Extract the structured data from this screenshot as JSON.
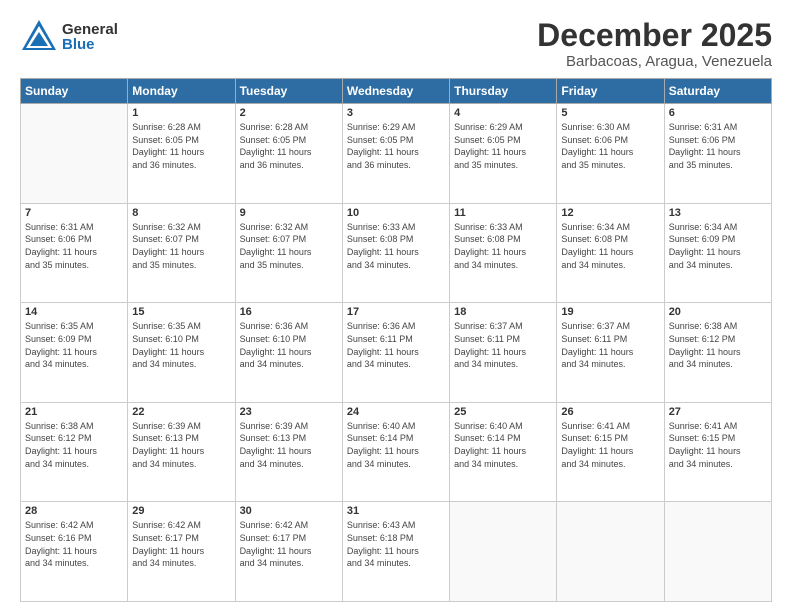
{
  "header": {
    "logo_general": "General",
    "logo_blue": "Blue",
    "month": "December 2025",
    "location": "Barbacoas, Aragua, Venezuela"
  },
  "weekdays": [
    "Sunday",
    "Monday",
    "Tuesday",
    "Wednesday",
    "Thursday",
    "Friday",
    "Saturday"
  ],
  "weeks": [
    [
      {
        "day": "",
        "sunrise": "",
        "sunset": "",
        "daylight": ""
      },
      {
        "day": "1",
        "sunrise": "Sunrise: 6:28 AM",
        "sunset": "Sunset: 6:05 PM",
        "daylight": "Daylight: 11 hours and 36 minutes."
      },
      {
        "day": "2",
        "sunrise": "Sunrise: 6:28 AM",
        "sunset": "Sunset: 6:05 PM",
        "daylight": "Daylight: 11 hours and 36 minutes."
      },
      {
        "day": "3",
        "sunrise": "Sunrise: 6:29 AM",
        "sunset": "Sunset: 6:05 PM",
        "daylight": "Daylight: 11 hours and 36 minutes."
      },
      {
        "day": "4",
        "sunrise": "Sunrise: 6:29 AM",
        "sunset": "Sunset: 6:05 PM",
        "daylight": "Daylight: 11 hours and 35 minutes."
      },
      {
        "day": "5",
        "sunrise": "Sunrise: 6:30 AM",
        "sunset": "Sunset: 6:06 PM",
        "daylight": "Daylight: 11 hours and 35 minutes."
      },
      {
        "day": "6",
        "sunrise": "Sunrise: 6:31 AM",
        "sunset": "Sunset: 6:06 PM",
        "daylight": "Daylight: 11 hours and 35 minutes."
      }
    ],
    [
      {
        "day": "7",
        "sunrise": "Sunrise: 6:31 AM",
        "sunset": "Sunset: 6:06 PM",
        "daylight": "Daylight: 11 hours and 35 minutes."
      },
      {
        "day": "8",
        "sunrise": "Sunrise: 6:32 AM",
        "sunset": "Sunset: 6:07 PM",
        "daylight": "Daylight: 11 hours and 35 minutes."
      },
      {
        "day": "9",
        "sunrise": "Sunrise: 6:32 AM",
        "sunset": "Sunset: 6:07 PM",
        "daylight": "Daylight: 11 hours and 35 minutes."
      },
      {
        "day": "10",
        "sunrise": "Sunrise: 6:33 AM",
        "sunset": "Sunset: 6:08 PM",
        "daylight": "Daylight: 11 hours and 34 minutes."
      },
      {
        "day": "11",
        "sunrise": "Sunrise: 6:33 AM",
        "sunset": "Sunset: 6:08 PM",
        "daylight": "Daylight: 11 hours and 34 minutes."
      },
      {
        "day": "12",
        "sunrise": "Sunrise: 6:34 AM",
        "sunset": "Sunset: 6:08 PM",
        "daylight": "Daylight: 11 hours and 34 minutes."
      },
      {
        "day": "13",
        "sunrise": "Sunrise: 6:34 AM",
        "sunset": "Sunset: 6:09 PM",
        "daylight": "Daylight: 11 hours and 34 minutes."
      }
    ],
    [
      {
        "day": "14",
        "sunrise": "Sunrise: 6:35 AM",
        "sunset": "Sunset: 6:09 PM",
        "daylight": "Daylight: 11 hours and 34 minutes."
      },
      {
        "day": "15",
        "sunrise": "Sunrise: 6:35 AM",
        "sunset": "Sunset: 6:10 PM",
        "daylight": "Daylight: 11 hours and 34 minutes."
      },
      {
        "day": "16",
        "sunrise": "Sunrise: 6:36 AM",
        "sunset": "Sunset: 6:10 PM",
        "daylight": "Daylight: 11 hours and 34 minutes."
      },
      {
        "day": "17",
        "sunrise": "Sunrise: 6:36 AM",
        "sunset": "Sunset: 6:11 PM",
        "daylight": "Daylight: 11 hours and 34 minutes."
      },
      {
        "day": "18",
        "sunrise": "Sunrise: 6:37 AM",
        "sunset": "Sunset: 6:11 PM",
        "daylight": "Daylight: 11 hours and 34 minutes."
      },
      {
        "day": "19",
        "sunrise": "Sunrise: 6:37 AM",
        "sunset": "Sunset: 6:11 PM",
        "daylight": "Daylight: 11 hours and 34 minutes."
      },
      {
        "day": "20",
        "sunrise": "Sunrise: 6:38 AM",
        "sunset": "Sunset: 6:12 PM",
        "daylight": "Daylight: 11 hours and 34 minutes."
      }
    ],
    [
      {
        "day": "21",
        "sunrise": "Sunrise: 6:38 AM",
        "sunset": "Sunset: 6:12 PM",
        "daylight": "Daylight: 11 hours and 34 minutes."
      },
      {
        "day": "22",
        "sunrise": "Sunrise: 6:39 AM",
        "sunset": "Sunset: 6:13 PM",
        "daylight": "Daylight: 11 hours and 34 minutes."
      },
      {
        "day": "23",
        "sunrise": "Sunrise: 6:39 AM",
        "sunset": "Sunset: 6:13 PM",
        "daylight": "Daylight: 11 hours and 34 minutes."
      },
      {
        "day": "24",
        "sunrise": "Sunrise: 6:40 AM",
        "sunset": "Sunset: 6:14 PM",
        "daylight": "Daylight: 11 hours and 34 minutes."
      },
      {
        "day": "25",
        "sunrise": "Sunrise: 6:40 AM",
        "sunset": "Sunset: 6:14 PM",
        "daylight": "Daylight: 11 hours and 34 minutes."
      },
      {
        "day": "26",
        "sunrise": "Sunrise: 6:41 AM",
        "sunset": "Sunset: 6:15 PM",
        "daylight": "Daylight: 11 hours and 34 minutes."
      },
      {
        "day": "27",
        "sunrise": "Sunrise: 6:41 AM",
        "sunset": "Sunset: 6:15 PM",
        "daylight": "Daylight: 11 hours and 34 minutes."
      }
    ],
    [
      {
        "day": "28",
        "sunrise": "Sunrise: 6:42 AM",
        "sunset": "Sunset: 6:16 PM",
        "daylight": "Daylight: 11 hours and 34 minutes."
      },
      {
        "day": "29",
        "sunrise": "Sunrise: 6:42 AM",
        "sunset": "Sunset: 6:17 PM",
        "daylight": "Daylight: 11 hours and 34 minutes."
      },
      {
        "day": "30",
        "sunrise": "Sunrise: 6:42 AM",
        "sunset": "Sunset: 6:17 PM",
        "daylight": "Daylight: 11 hours and 34 minutes."
      },
      {
        "day": "31",
        "sunrise": "Sunrise: 6:43 AM",
        "sunset": "Sunset: 6:18 PM",
        "daylight": "Daylight: 11 hours and 34 minutes."
      },
      {
        "day": "",
        "sunrise": "",
        "sunset": "",
        "daylight": ""
      },
      {
        "day": "",
        "sunrise": "",
        "sunset": "",
        "daylight": ""
      },
      {
        "day": "",
        "sunrise": "",
        "sunset": "",
        "daylight": ""
      }
    ]
  ]
}
